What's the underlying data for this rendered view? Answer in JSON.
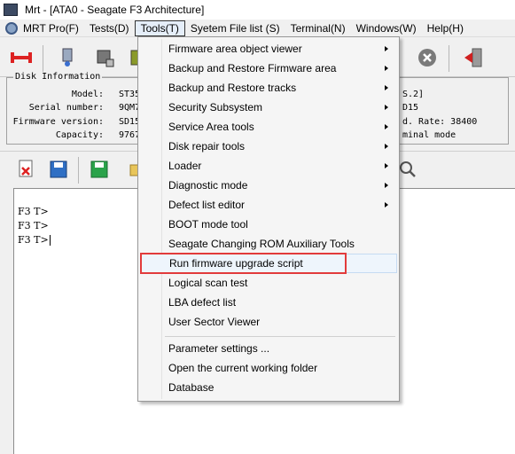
{
  "window": {
    "title": "Mrt - [ATA0 - Seagate F3 Architecture]"
  },
  "menubar": {
    "items": [
      "MRT Pro(F)",
      "Tests(D)",
      "Tools(T)",
      "Syetem File list (S)",
      "Terminal(N)",
      "Windows(W)",
      "Help(H)"
    ],
    "active": "Tools(T)"
  },
  "disk_info": {
    "legend": "Disk Information",
    "model_label": "Model:",
    "model_value": "ST35",
    "serial_label": "Serial number:",
    "serial_value": "9QM7",
    "firmware_label": "Firmware version:",
    "firmware_value": "SD15",
    "capacity_label": "Capacity:",
    "capacity_value": "9767",
    "right_1": "S.2]",
    "right_2": "D15",
    "right_3": "d. Rate: 38400",
    "right_4": "minal mode"
  },
  "terminal": {
    "lines": [
      "F3 T>",
      "F3 T>",
      "F3 T>"
    ]
  },
  "tools_menu": {
    "items": [
      {
        "label": "Firmware area object viewer",
        "submenu": true
      },
      {
        "label": "Backup and Restore Firmware area",
        "submenu": true
      },
      {
        "label": "Backup and Restore tracks",
        "submenu": true
      },
      {
        "label": "Security Subsystem",
        "submenu": true
      },
      {
        "label": "Service Area tools",
        "submenu": true
      },
      {
        "label": "Disk repair tools",
        "submenu": true
      },
      {
        "label": "Loader",
        "submenu": true
      },
      {
        "label": "Diagnostic mode",
        "submenu": true
      },
      {
        "label": "Defect list editor",
        "submenu": true
      },
      {
        "label": "BOOT mode tool",
        "submenu": false
      },
      {
        "label": "Seagate Changing ROM Auxiliary Tools",
        "submenu": false
      },
      {
        "label": "Run firmware upgrade script",
        "submenu": false,
        "highlighted": true
      },
      {
        "label": "Logical scan test",
        "submenu": false
      },
      {
        "label": "LBA defect list",
        "submenu": false
      },
      {
        "label": "User Sector Viewer",
        "submenu": false
      },
      {
        "label": "Parameter settings ...",
        "submenu": false
      },
      {
        "label": "Open the current working folder",
        "submenu": false
      },
      {
        "label": "Database",
        "submenu": false
      }
    ]
  },
  "colors": {
    "highlight_box": "#e23b3b",
    "hover_bg": "#eef5fc"
  }
}
